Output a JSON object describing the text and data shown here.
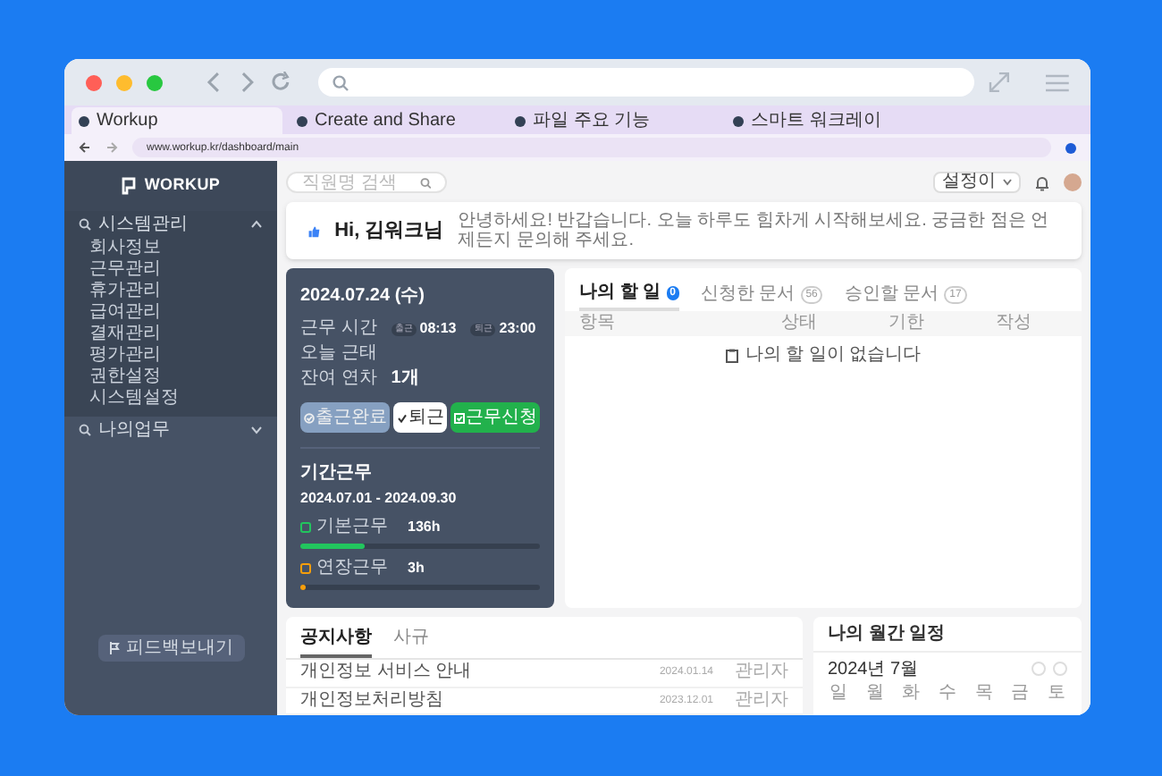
{
  "browser": {
    "tabs": [
      {
        "title": "Workup",
        "selected": true
      },
      {
        "title": "Create and Share",
        "selected": false
      },
      {
        "title": "파일 주요 기능",
        "selected": false
      },
      {
        "title": "스마트 워크레이",
        "selected": false
      }
    ],
    "url": "www.workup.kr/dashboard/main"
  },
  "sidebar": {
    "logo": "WORKUP",
    "menus": [
      {
        "label": "시스템관리",
        "expanded": true,
        "children": [
          {
            "label": "회사정보"
          },
          {
            "label": "근무관리"
          },
          {
            "label": "휴가관리"
          },
          {
            "label": "급여관리"
          },
          {
            "label": "결재관리"
          },
          {
            "label": "평가관리"
          },
          {
            "label": "권한설정"
          },
          {
            "label": "시스템설정"
          }
        ]
      },
      {
        "label": "나의업무",
        "expanded": false
      }
    ],
    "feedback_button": "피드백보내기"
  },
  "header": {
    "search_placeholder": "직원명 검색",
    "select": "설정이"
  },
  "welcome": {
    "title": "Hi, 김워크님",
    "message": "안녕하세요! 반갑습니다. 오늘 하루도 힘차게 시작해보세요. 궁금한 점은 언제든지 문의해 주세요."
  },
  "attendance": {
    "date": "2024.07.24 (수)",
    "rows": [
      {
        "label": "근무 시간",
        "kind": "times",
        "values": [
          {
            "tag": "출근",
            "time": "08:13"
          },
          {
            "tag": "퇴근",
            "time": "23:00"
          }
        ]
      },
      {
        "label": "오늘 근태",
        "kind": "text",
        "value": ""
      },
      {
        "label": "잔여 연차",
        "kind": "text",
        "value": "1개"
      }
    ],
    "buttons": [
      {
        "label": "출근완료",
        "kind": "done",
        "disabled": true
      },
      {
        "label": "퇴근",
        "kind": "check",
        "disabled": false
      },
      {
        "label": "근무신청",
        "kind": "apply",
        "disabled": false
      }
    ],
    "period_title": "기간근무",
    "period": "2024.07.01 - 2024.09.30",
    "meters": [
      {
        "label": "기본근무",
        "value": "136h",
        "level": 0.27,
        "color": "#22c55e"
      },
      {
        "label": "연장근무",
        "value": "3h",
        "level": 0.02,
        "color": "#f59e0b"
      }
    ]
  },
  "tasks": {
    "tabs": [
      {
        "label": "나의 할 일",
        "count": "0",
        "selected": true
      },
      {
        "label": "신청한 문서",
        "count": "56",
        "selected": false
      },
      {
        "label": "승인할 문서",
        "count": "17",
        "selected": false
      }
    ],
    "columns": [
      "항목",
      "상태",
      "기한",
      "작성"
    ],
    "empty": "나의 할 일이 없습니다"
  },
  "notices": {
    "tabs": [
      {
        "label": "공지사항",
        "selected": true
      },
      {
        "label": "사규",
        "selected": false
      }
    ],
    "rows": [
      {
        "title": "개인정보 서비스 안내",
        "date": "2024.01.14",
        "author": "관리자"
      },
      {
        "title": "개인정보처리방침",
        "date": "2023.12.01",
        "author": "관리자"
      }
    ]
  },
  "calendar": {
    "title": "나의 월간 일정",
    "month": "2024년 7월",
    "weekdays": [
      "일",
      "월",
      "화",
      "수",
      "목",
      "금",
      "토"
    ]
  }
}
